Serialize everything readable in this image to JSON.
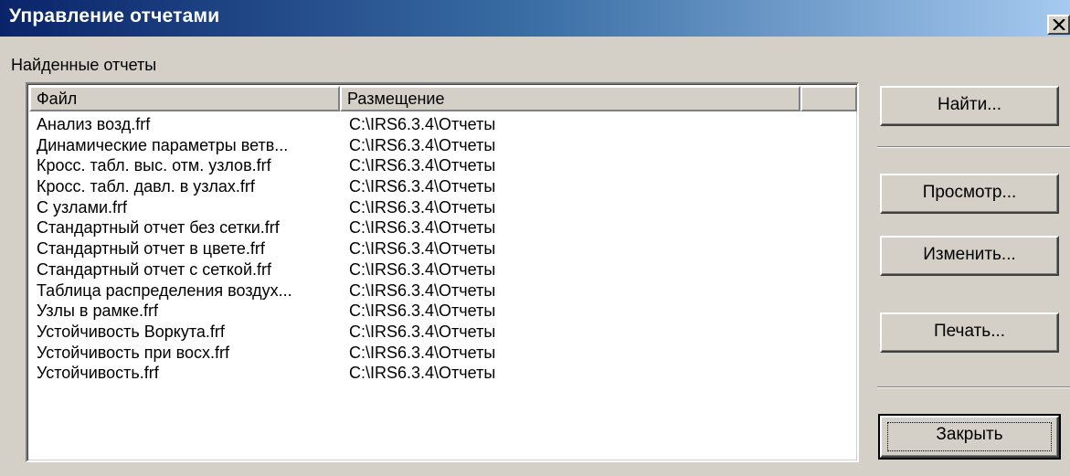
{
  "window": {
    "title": "Управление отчетами",
    "close_glyph": "×",
    "colors": {
      "title_start": "#0a246a",
      "title_end": "#a6caf0",
      "face": "#d4d0c8"
    }
  },
  "group_label": "Найденные отчеты",
  "list": {
    "columns": [
      "Файл",
      "Размещение",
      ""
    ],
    "rows": [
      {
        "file": "Анализ возд.frf",
        "location": "C:\\IRS6.3.4\\Отчеты"
      },
      {
        "file": "Динамические параметры ветв...",
        "location": "C:\\IRS6.3.4\\Отчеты"
      },
      {
        "file": "Кросс. табл. выс. отм. узлов.frf",
        "location": "C:\\IRS6.3.4\\Отчеты"
      },
      {
        "file": "Кросс. табл. давл. в узлах.frf",
        "location": "C:\\IRS6.3.4\\Отчеты"
      },
      {
        "file": "С узлами.frf",
        "location": "C:\\IRS6.3.4\\Отчеты"
      },
      {
        "file": "Стандартный отчет без сетки.frf",
        "location": "C:\\IRS6.3.4\\Отчеты"
      },
      {
        "file": "Стандартный отчет в цвете.frf",
        "location": "C:\\IRS6.3.4\\Отчеты"
      },
      {
        "file": "Стандартный отчет с сеткой.frf",
        "location": "C:\\IRS6.3.4\\Отчеты"
      },
      {
        "file": "Таблица распределения воздух...",
        "location": "C:\\IRS6.3.4\\Отчеты"
      },
      {
        "file": "Узлы в рамке.frf",
        "location": "C:\\IRS6.3.4\\Отчеты"
      },
      {
        "file": "Устойчивость Воркута.frf",
        "location": "C:\\IRS6.3.4\\Отчеты"
      },
      {
        "file": "Устойчивость при восх.frf",
        "location": "C:\\IRS6.3.4\\Отчеты"
      },
      {
        "file": "Устойчивость.frf",
        "location": "C:\\IRS6.3.4\\Отчеты"
      }
    ]
  },
  "buttons": {
    "find": "Найти...",
    "view": "Просмотр...",
    "edit": "Изменить...",
    "print": "Печать...",
    "close": "Закрыть"
  },
  "icons": {
    "close": "close-icon"
  }
}
